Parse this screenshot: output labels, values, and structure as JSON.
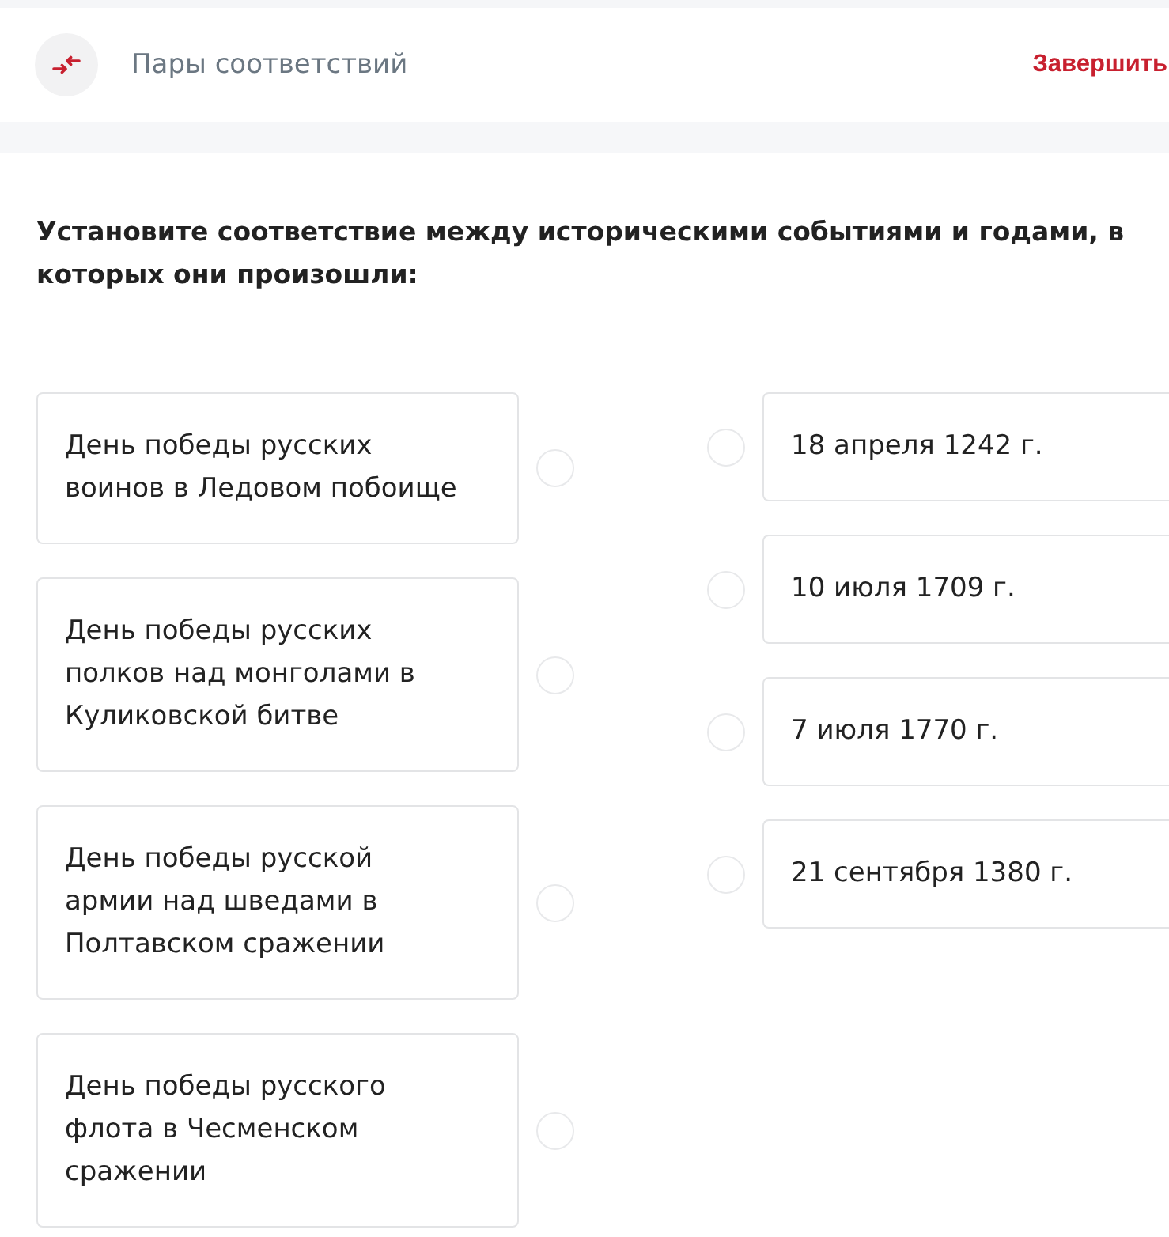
{
  "header": {
    "title": "Пары соответствий",
    "finish_button": "Завершить"
  },
  "question": "Установите соответствие между историческими событиями и годами, в которых они произошли:",
  "left_items": [
    {
      "text": "День победы русских воинов в Ледовом побоище",
      "selected": false
    },
    {
      "text": "День победы русских полков над монголами в Куликовской битве",
      "selected": false
    },
    {
      "text": "День победы русской армии над шведами в Полтавском сражении",
      "selected": false
    },
    {
      "text": "День победы русского флота в Чесменском сражении",
      "selected": false
    }
  ],
  "right_items": [
    {
      "text": "18 апреля 1242 г.",
      "selected": false
    },
    {
      "text": "10 июля 1709 г.",
      "selected": false
    },
    {
      "text": "7 июля 1770 г.",
      "selected": false
    },
    {
      "text": "21 сентября 1380 г.",
      "selected": false
    }
  ]
}
